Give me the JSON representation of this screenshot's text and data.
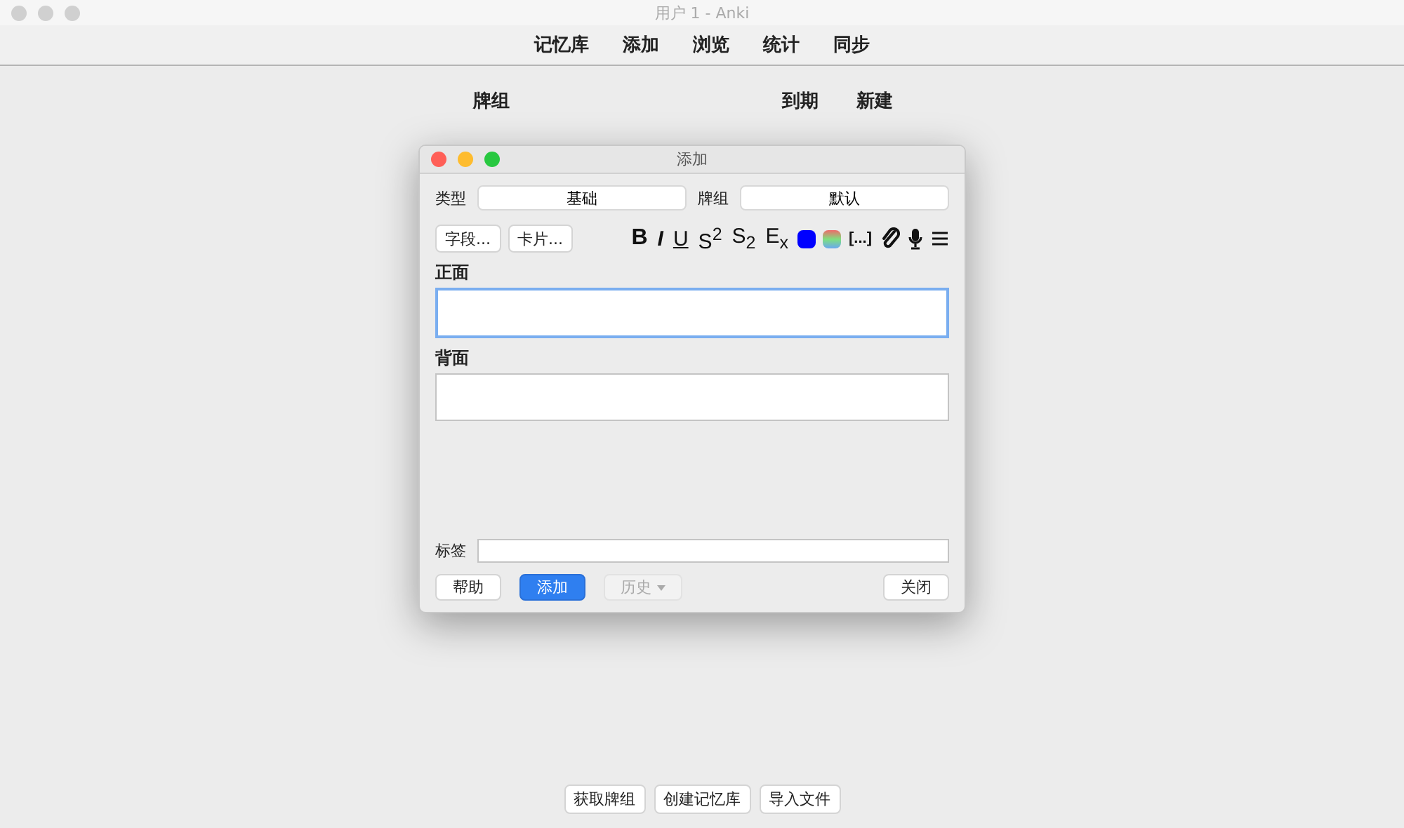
{
  "window": {
    "title": "用户 1 - Anki",
    "active": false
  },
  "toolbar": [
    "记忆库",
    "添加",
    "浏览",
    "统计",
    "同步"
  ],
  "deck_list": {
    "columns": [
      "牌组",
      "到期",
      "新建"
    ]
  },
  "bottom_buttons": [
    "获取牌组",
    "创建记忆库",
    "导入文件"
  ],
  "dialog": {
    "title": "添加",
    "type_label": "类型",
    "type_value": "基础",
    "deck_label": "牌组",
    "deck_value": "默认",
    "field_buttons": [
      "字段...",
      "卡片..."
    ],
    "format_tools": [
      {
        "kind": "bold",
        "label": "B"
      },
      {
        "kind": "italic",
        "label": "I"
      },
      {
        "kind": "underline",
        "label": "U"
      },
      {
        "kind": "superscript",
        "label": "S$^{2}$"
      },
      {
        "kind": "subscript",
        "label": "S$_{2}$"
      },
      {
        "kind": "clear",
        "label": "E$_{x}$"
      },
      {
        "kind": "color"
      },
      {
        "kind": "gradient"
      },
      {
        "kind": "cloze",
        "label": "[...]"
      },
      {
        "kind": "attach"
      },
      {
        "kind": "record"
      },
      {
        "kind": "menu"
      }
    ],
    "fields": [
      {
        "label": "正面",
        "focused": true
      },
      {
        "label": "背面",
        "focused": false
      }
    ],
    "tags_label": "标签",
    "buttons": [
      {
        "label": "帮助",
        "kind": "normal",
        "disabled": false
      },
      {
        "label": "添加",
        "kind": "default",
        "disabled": false
      },
      {
        "label": "历史",
        "kind": "menu",
        "disabled": true
      },
      {
        "label": "关闭",
        "kind": "normal",
        "disabled": false
      }
    ]
  }
}
